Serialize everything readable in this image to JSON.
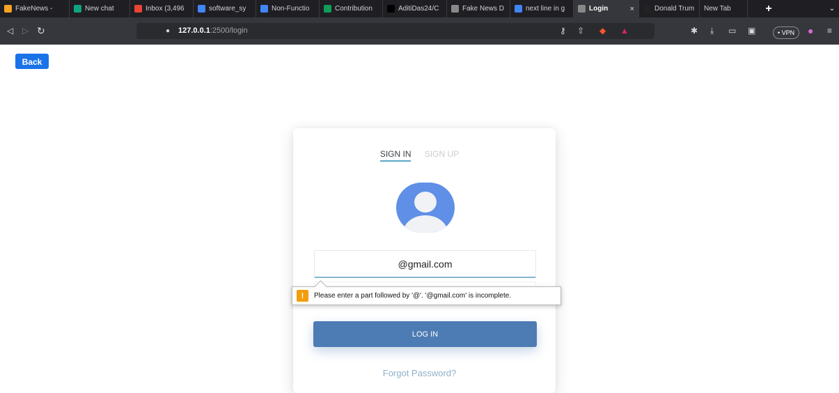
{
  "browser": {
    "tabs": [
      {
        "title": "FakeNews - ",
        "icon": "fire-icon",
        "color": "#f4a322",
        "width": 100
      },
      {
        "title": "New chat",
        "icon": "chatgpt-icon",
        "color": "#10a37f",
        "width": 87
      },
      {
        "title": "Inbox (3,496",
        "icon": "gmail-icon",
        "color": "#ea4335",
        "width": 91
      },
      {
        "title": "software_sy",
        "icon": "docs-icon",
        "color": "#4285f4",
        "width": 90
      },
      {
        "title": "Non-Functio",
        "icon": "docs-icon",
        "color": "#4285f4",
        "width": 91
      },
      {
        "title": "Contribution",
        "icon": "sheets-icon",
        "color": "#0f9d58",
        "width": 91
      },
      {
        "title": "AditiDas24/C",
        "icon": "github-icon",
        "color": "#000000",
        "width": 92
      },
      {
        "title": "Fake News D",
        "icon": "globe-icon",
        "color": "#888888",
        "width": 91
      },
      {
        "title": "next line in g",
        "icon": "google-icon",
        "color": "#4285f4",
        "width": 91
      },
      {
        "title": "Login",
        "icon": "globe-icon",
        "color": "#888888",
        "width": 94,
        "active": true
      },
      {
        "title": "Donald Trum",
        "icon": "globe-icon",
        "color": "#222222",
        "width": 87
      },
      {
        "title": "New Tab",
        "icon": "",
        "color": "#222222",
        "width": 69
      }
    ],
    "close_glyph": "×",
    "new_tab_glyph": "+",
    "url_host": "127.0.0.1",
    "url_port_path": ":2500/login",
    "vpn_label": "• VPN"
  },
  "page": {
    "back_label": "Back",
    "tab_signin": "SIGN IN",
    "tab_signup": "SIGN UP",
    "email_value": "@gmail.com",
    "validation_message": "Please enter a part followed by '@'. '@gmail.com' is incomplete.",
    "warning_glyph": "!",
    "login_label": "LOG IN",
    "forgot_label": "Forgot Password?"
  },
  "colors": {
    "login_button": "#4d7bb4",
    "back_button": "#1a73e8",
    "avatar": "#5f8fe7"
  }
}
